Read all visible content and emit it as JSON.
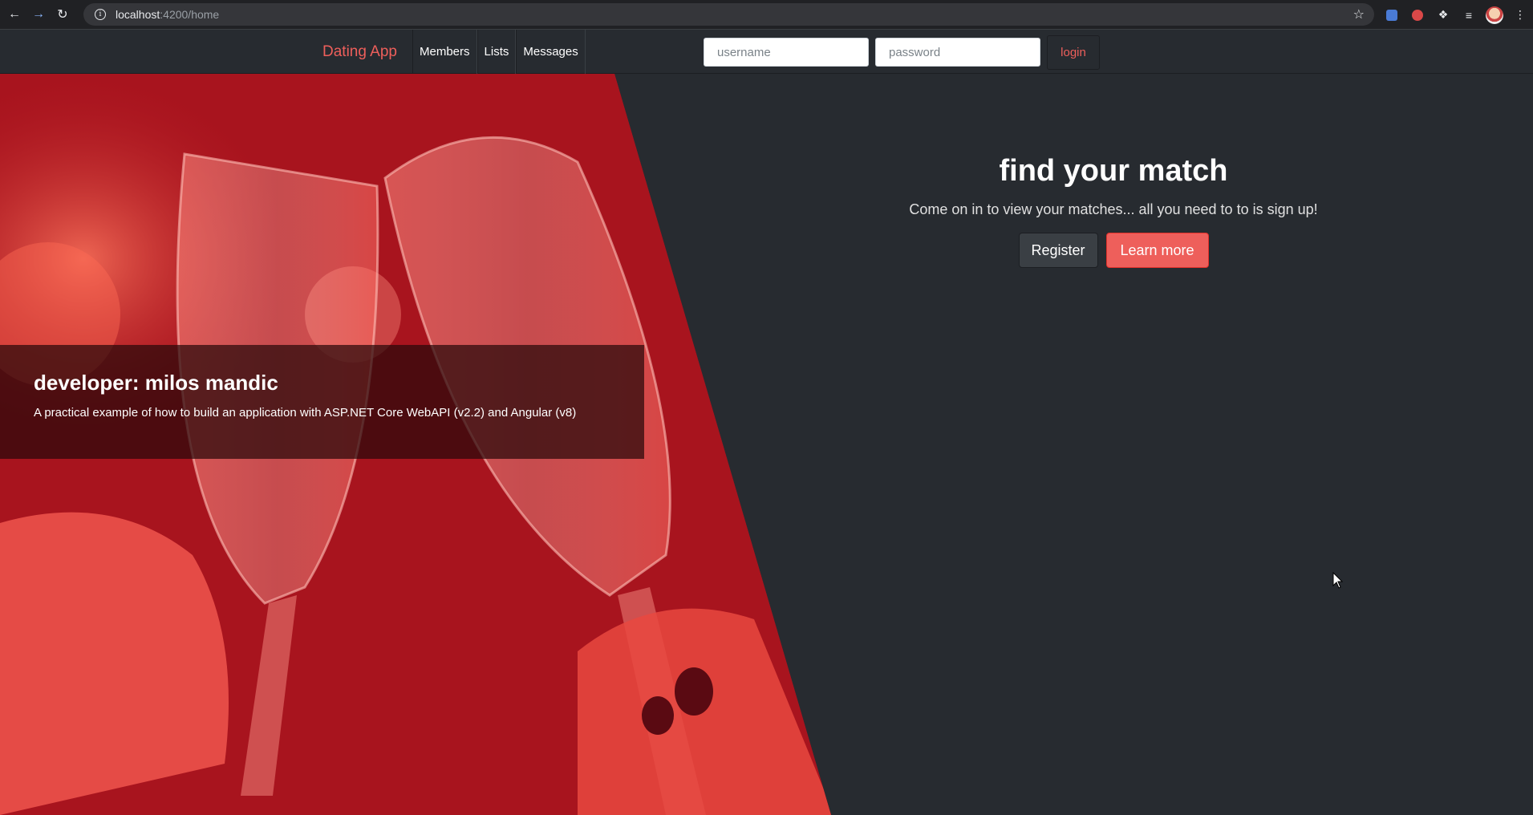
{
  "browser": {
    "url_host": "localhost",
    "url_path": ":4200/home",
    "icons": [
      "back-icon",
      "forward-icon",
      "reload-icon",
      "info-icon",
      "star-icon",
      "extension-icon",
      "puzzle-icon",
      "reading-list-icon",
      "profile-icon",
      "menu-icon"
    ]
  },
  "navbar": {
    "brand": "Dating App",
    "links": [
      "Members",
      "Lists",
      "Messages"
    ],
    "username_placeholder": "username",
    "password_placeholder": "password",
    "login_label": "login"
  },
  "hero": {
    "caption_title": "developer: milos mandic",
    "caption_text": "A practical example of how to build an application with ASP.NET Core WebAPI (v2.2) and Angular (v8)",
    "heading": "find your match",
    "lead": "Come on in to view your matches... all you need to to is sign up!",
    "register_label": "Register",
    "learn_more_label": "Learn more"
  },
  "colors": {
    "accent": "#ee5f5b",
    "background": "#272b30",
    "photo_tint": "#b51923"
  }
}
